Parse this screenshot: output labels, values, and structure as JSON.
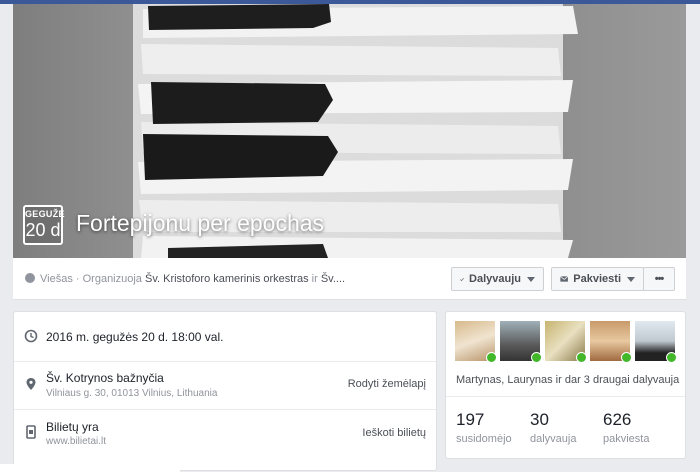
{
  "event": {
    "month": "GEGUŽĖ",
    "day": "20 d",
    "title": "Fortepijonu per epochas"
  },
  "info": {
    "privacy": "Viešas",
    "separator": " · ",
    "organizer_prefix": "Organizuoja ",
    "organizer_1": "Šv. Kristoforo kamerinis orkestras",
    "conj": " ir ",
    "organizer_2": "Šv...."
  },
  "buttons": {
    "going": "Dalyvauju",
    "invite": "Pakviesti",
    "more": "•••"
  },
  "details": {
    "datetime": "2016 m. gegužės 20 d. 18:00 val.",
    "venue": "Šv. Kotrynos bažnyčia",
    "address": "Vilniaus g. 30, 01013 Vilnius, Lithuania",
    "map_link": "Rodyti žemėlapį",
    "tickets_label": "Bilietų yra",
    "tickets_site": "www.bilietai.lt",
    "tickets_link": "Ieškoti bilietų"
  },
  "attendance": {
    "names": "Martynas, Laurynas",
    "conj": " ir ",
    "more": "dar 3 draugai",
    "verb": " dalyvauja",
    "stats": [
      {
        "value": "197",
        "label": "susidomėjo"
      },
      {
        "value": "30",
        "label": "dalyvauja"
      },
      {
        "value": "626",
        "label": "pakviesta"
      }
    ]
  },
  "colors": {
    "brand": "#3b5998",
    "check": "#42b72a"
  }
}
